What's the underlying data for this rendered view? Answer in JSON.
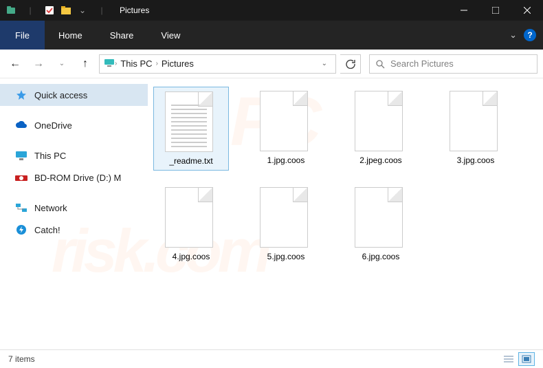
{
  "window": {
    "title": "Pictures"
  },
  "ribbon": {
    "file": "File",
    "tabs": [
      "Home",
      "Share",
      "View"
    ]
  },
  "address": {
    "crumbs": [
      "This PC",
      "Pictures"
    ]
  },
  "search": {
    "placeholder": "Search Pictures"
  },
  "sidebar": {
    "items": [
      {
        "label": "Quick access",
        "selected": true,
        "icon": "star"
      },
      {
        "label": "OneDrive",
        "selected": false,
        "icon": "cloud"
      },
      {
        "label": "This PC",
        "selected": false,
        "icon": "pc"
      },
      {
        "label": "BD-ROM Drive (D:) M",
        "selected": false,
        "icon": "disc"
      },
      {
        "label": "Network",
        "selected": false,
        "icon": "net"
      },
      {
        "label": "Catch!",
        "selected": false,
        "icon": "bolt"
      }
    ]
  },
  "files": [
    {
      "name": "_readme.txt",
      "type": "txt",
      "selected": true
    },
    {
      "name": "1.jpg.coos",
      "type": "blank",
      "selected": false
    },
    {
      "name": "2.jpeg.coos",
      "type": "blank",
      "selected": false
    },
    {
      "name": "3.jpg.coos",
      "type": "blank",
      "selected": false
    },
    {
      "name": "4.jpg.coos",
      "type": "blank",
      "selected": false
    },
    {
      "name": "5.jpg.coos",
      "type": "blank",
      "selected": false
    },
    {
      "name": "6.jpg.coos",
      "type": "blank",
      "selected": false
    }
  ],
  "status": {
    "text": "7 items"
  },
  "watermark": {
    "a": "PC",
    "b": "risk.com"
  }
}
